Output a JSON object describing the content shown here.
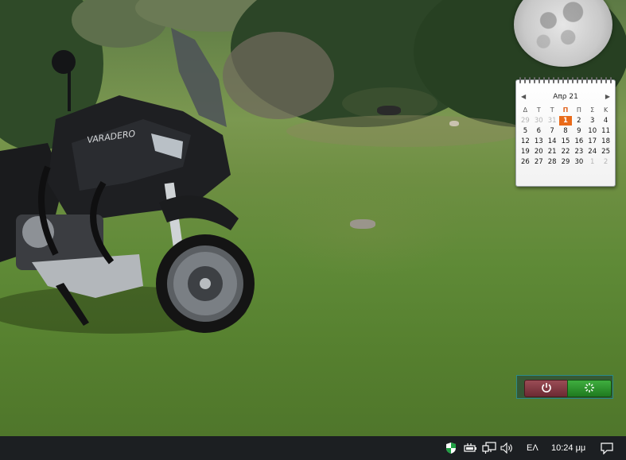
{
  "calendar": {
    "month_title": "Απρ 21",
    "weekdays": [
      "Δ",
      "Τ",
      "Τ",
      "Π",
      "Π",
      "Σ",
      "Κ"
    ],
    "highlight_weekday_index": 3,
    "weeks": [
      [
        {
          "d": "29",
          "other": true
        },
        {
          "d": "30",
          "other": true
        },
        {
          "d": "31",
          "other": true
        },
        {
          "d": "1",
          "today": true
        },
        {
          "d": "2"
        },
        {
          "d": "3"
        },
        {
          "d": "4"
        }
      ],
      [
        {
          "d": "5"
        },
        {
          "d": "6"
        },
        {
          "d": "7"
        },
        {
          "d": "8"
        },
        {
          "d": "9"
        },
        {
          "d": "10"
        },
        {
          "d": "11"
        }
      ],
      [
        {
          "d": "12"
        },
        {
          "d": "13"
        },
        {
          "d": "14"
        },
        {
          "d": "15"
        },
        {
          "d": "16"
        },
        {
          "d": "17"
        },
        {
          "d": "18"
        }
      ],
      [
        {
          "d": "19"
        },
        {
          "d": "20"
        },
        {
          "d": "21"
        },
        {
          "d": "22"
        },
        {
          "d": "23"
        },
        {
          "d": "24"
        },
        {
          "d": "25"
        }
      ],
      [
        {
          "d": "26"
        },
        {
          "d": "27"
        },
        {
          "d": "28"
        },
        {
          "d": "29"
        },
        {
          "d": "30"
        },
        {
          "d": "1",
          "other": true
        },
        {
          "d": "2",
          "other": true
        }
      ]
    ],
    "accent_color": "#e96a19"
  },
  "wallpaper": {
    "bike_brand_text": "VARADERO"
  },
  "shutdown_gadget": {
    "power_icon": "power-icon",
    "restart_icon": "restart-icon"
  },
  "taskbar": {
    "tray_icons": [
      "defender-shield-icon",
      "battery-icon",
      "network-icon",
      "volume-icon"
    ],
    "language": "ΕΛ",
    "clock": "10:24 μμ",
    "notification_icon": "action-center-icon"
  }
}
